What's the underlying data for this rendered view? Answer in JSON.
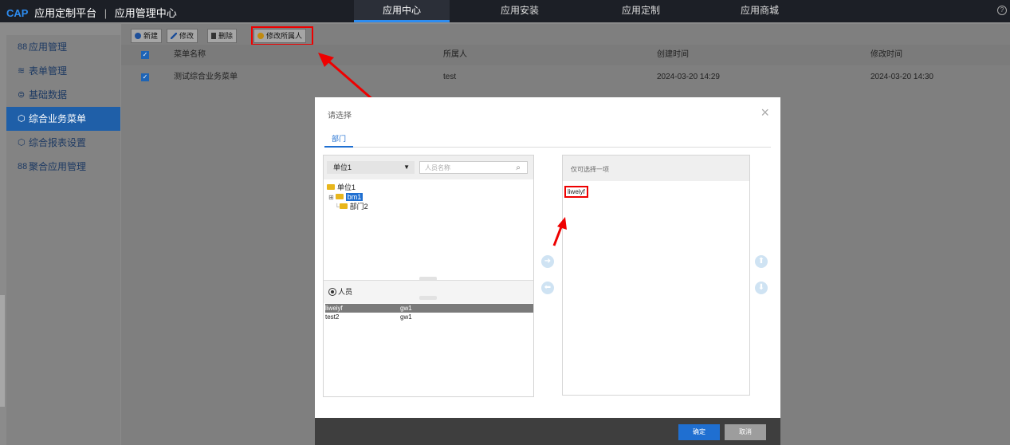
{
  "topbar": {
    "brand_cap": "CAP",
    "brand_platform": "应用定制平台",
    "brand_center": "应用管理中心",
    "nav": [
      "应用中心",
      "应用安装",
      "应用定制",
      "应用商城"
    ],
    "active_nav": "应用中心"
  },
  "sidebar": {
    "items": [
      {
        "label": "应用管理",
        "icon": "grid-icon"
      },
      {
        "label": "表单管理",
        "icon": "layers-icon"
      },
      {
        "label": "基础数据",
        "icon": "database-icon"
      },
      {
        "label": "综合业务菜单",
        "icon": "cube-icon"
      },
      {
        "label": "综合报表设置",
        "icon": "cube-icon"
      },
      {
        "label": "聚合应用管理",
        "icon": "grid-icon"
      }
    ],
    "active": "综合业务菜单"
  },
  "toolbar": {
    "new_label": "新建",
    "edit_label": "修改",
    "delete_label": "删除",
    "change_owner_label": "修改所属人"
  },
  "table": {
    "columns": [
      "菜单名称",
      "所属人",
      "创建时间",
      "修改时间"
    ],
    "rows": [
      {
        "name": "测试综合业务菜单",
        "owner": "test",
        "created": "2024-03-20 14:29",
        "modified": "2024-03-20 14:30"
      }
    ]
  },
  "modal": {
    "title": "请选择",
    "tab": "部门",
    "unit_select": "单位1",
    "search_placeholder": "人员名称",
    "tree": {
      "root": "单位1",
      "children": [
        "bm1",
        "部门2"
      ]
    },
    "people_label": "人员",
    "people": [
      {
        "name": "liweiyf",
        "position": "gw1",
        "selected": true
      },
      {
        "name": "test2",
        "position": "gw1",
        "selected": false
      }
    ],
    "right_hint": "仅可选择一项",
    "selected_items": [
      "liweiyf"
    ],
    "ok_label": "确定",
    "cancel_label": "取消"
  },
  "colors": {
    "accent": "#1f6fd1",
    "highlight": "#ee0000",
    "topbar_bg": "#1c1f26"
  }
}
